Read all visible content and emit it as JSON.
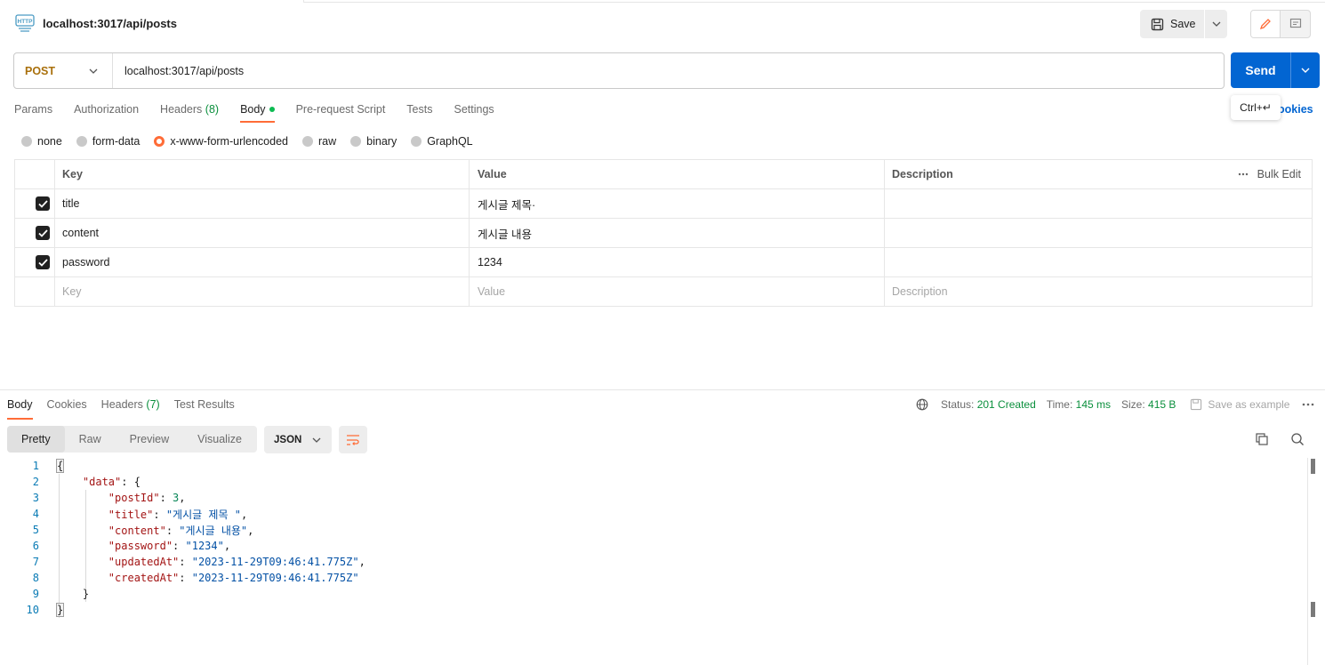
{
  "request": {
    "title": "localhost:3017/api/posts",
    "save_label": "Save",
    "method": "POST",
    "url": "localhost:3017/api/posts",
    "send_label": "Send",
    "send_tooltip": "Ctrl+↵",
    "cookies_label": "ookies"
  },
  "request_tabs": {
    "params": "Params",
    "authorization": "Authorization",
    "headers": "Headers",
    "headers_count": "(8)",
    "body": "Body",
    "prerequest": "Pre-request Script",
    "tests": "Tests",
    "settings": "Settings"
  },
  "body_types": {
    "none": "none",
    "form_data": "form-data",
    "urlencoded": "x-www-form-urlencoded",
    "raw": "raw",
    "binary": "binary",
    "graphql": "GraphQL",
    "selected": "x-www-form-urlencoded"
  },
  "params_table": {
    "headers": {
      "key": "Key",
      "value": "Value",
      "description": "Description",
      "bulk_edit": "Bulk Edit"
    },
    "rows": [
      {
        "key": "title",
        "value": "게시글 제목·",
        "checked": true
      },
      {
        "key": "content",
        "value": "게시글 내용",
        "checked": true
      },
      {
        "key": "password",
        "value": "1234",
        "checked": true
      }
    ],
    "placeholders": {
      "key": "Key",
      "value": "Value",
      "description": "Description"
    }
  },
  "response_tabs": {
    "body": "Body",
    "cookies": "Cookies",
    "headers": "Headers",
    "headers_count": "(7)",
    "test_results": "Test Results"
  },
  "response_meta": {
    "status_label": "Status:",
    "status_value": "201 Created",
    "time_label": "Time:",
    "time_value": "145 ms",
    "size_label": "Size:",
    "size_value": "415 B",
    "save_example": "Save as example"
  },
  "view_tabs": {
    "pretty": "Pretty",
    "raw": "Raw",
    "preview": "Preview",
    "visualize": "Visualize",
    "format": "JSON"
  },
  "code_lines": {
    "l1": "1",
    "l2": "2",
    "l3": "3",
    "l4": "4",
    "l5": "5",
    "l6": "6",
    "l7": "7",
    "l8": "8",
    "l9": "9",
    "l10": "10",
    "data_key": "\"data\"",
    "postId_key": "\"postId\"",
    "postId_val": "3",
    "title_key": "\"title\"",
    "title_val": "\"게시글 제목 \"",
    "content_key": "\"content\"",
    "content_val": "\"게시글 내용\"",
    "password_key": "\"password\"",
    "password_val": "\"1234\"",
    "updatedAt_key": "\"updatedAt\"",
    "updatedAt_val": "\"2023-11-29T09:46:41.775Z\"",
    "createdAt_key": "\"createdAt\"",
    "createdAt_val": "\"2023-11-29T09:46:41.775Z\""
  },
  "colors": {
    "accent": "#ff6c37",
    "send": "#0265d2",
    "method": "#a9700c",
    "status_ok": "#0a8f3c"
  }
}
